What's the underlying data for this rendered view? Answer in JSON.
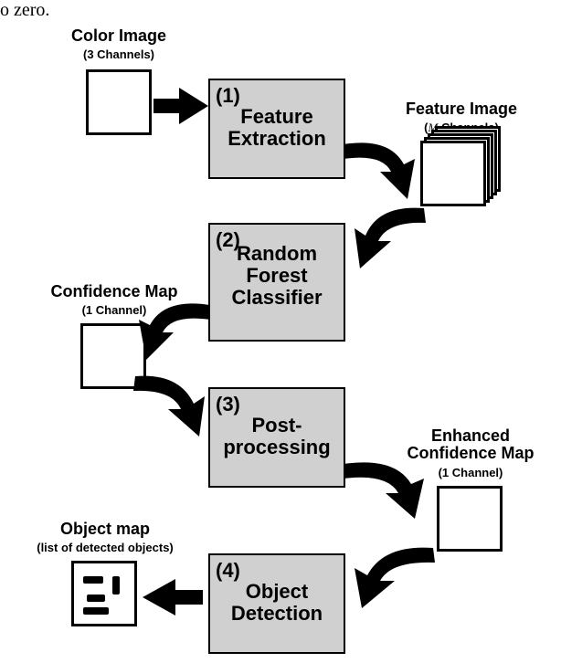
{
  "extraneous_text": "o zero.",
  "stages": {
    "s1": {
      "num": "(1)",
      "line1": "Feature",
      "line2": "Extraction"
    },
    "s2": {
      "num": "(2)",
      "line1": "Random",
      "line2": "Forest",
      "line3": "Classifier"
    },
    "s3": {
      "num": "(3)",
      "line1": "Post-",
      "line2": "processing"
    },
    "s4": {
      "num": "(4)",
      "line1": "Object",
      "line2": "Detection"
    }
  },
  "io": {
    "color_image": {
      "title": "Color Image",
      "sub": "(3 Channels)"
    },
    "feature_image": {
      "title": "Feature Image",
      "sub_prefix": "(",
      "sub_var": "M",
      "sub_suffix": " Channels)"
    },
    "confidence_map": {
      "title": "Confidence Map",
      "sub": "(1 Channel)"
    },
    "enhanced_confidence_map": {
      "title_line1": "Enhanced",
      "title_line2": "Confidence Map",
      "sub": "(1 Channel)"
    },
    "object_map": {
      "title": "Object map",
      "sub": "(list of detected objects)"
    }
  },
  "chart_data": {
    "type": "flowchart",
    "nodes": [
      {
        "id": "color_image",
        "label": "Color Image (3 Channels)",
        "kind": "data"
      },
      {
        "id": "feature_extraction",
        "label": "Feature Extraction",
        "kind": "process",
        "index": 1
      },
      {
        "id": "feature_image",
        "label": "Feature Image (M Channels)",
        "kind": "data"
      },
      {
        "id": "random_forest",
        "label": "Random Forest Classifier",
        "kind": "process",
        "index": 2
      },
      {
        "id": "confidence_map",
        "label": "Confidence Map (1 Channel)",
        "kind": "data"
      },
      {
        "id": "post_processing",
        "label": "Post-processing",
        "kind": "process",
        "index": 3
      },
      {
        "id": "enhanced_confidence_map",
        "label": "Enhanced Confidence Map (1 Channel)",
        "kind": "data"
      },
      {
        "id": "object_detection",
        "label": "Object Detection",
        "kind": "process",
        "index": 4
      },
      {
        "id": "object_map",
        "label": "Object map (list of detected objects)",
        "kind": "data"
      }
    ],
    "edges": [
      {
        "from": "color_image",
        "to": "feature_extraction"
      },
      {
        "from": "feature_extraction",
        "to": "feature_image"
      },
      {
        "from": "feature_image",
        "to": "random_forest"
      },
      {
        "from": "random_forest",
        "to": "confidence_map"
      },
      {
        "from": "confidence_map",
        "to": "post_processing"
      },
      {
        "from": "post_processing",
        "to": "enhanced_confidence_map"
      },
      {
        "from": "enhanced_confidence_map",
        "to": "object_detection"
      },
      {
        "from": "object_detection",
        "to": "object_map"
      }
    ]
  }
}
